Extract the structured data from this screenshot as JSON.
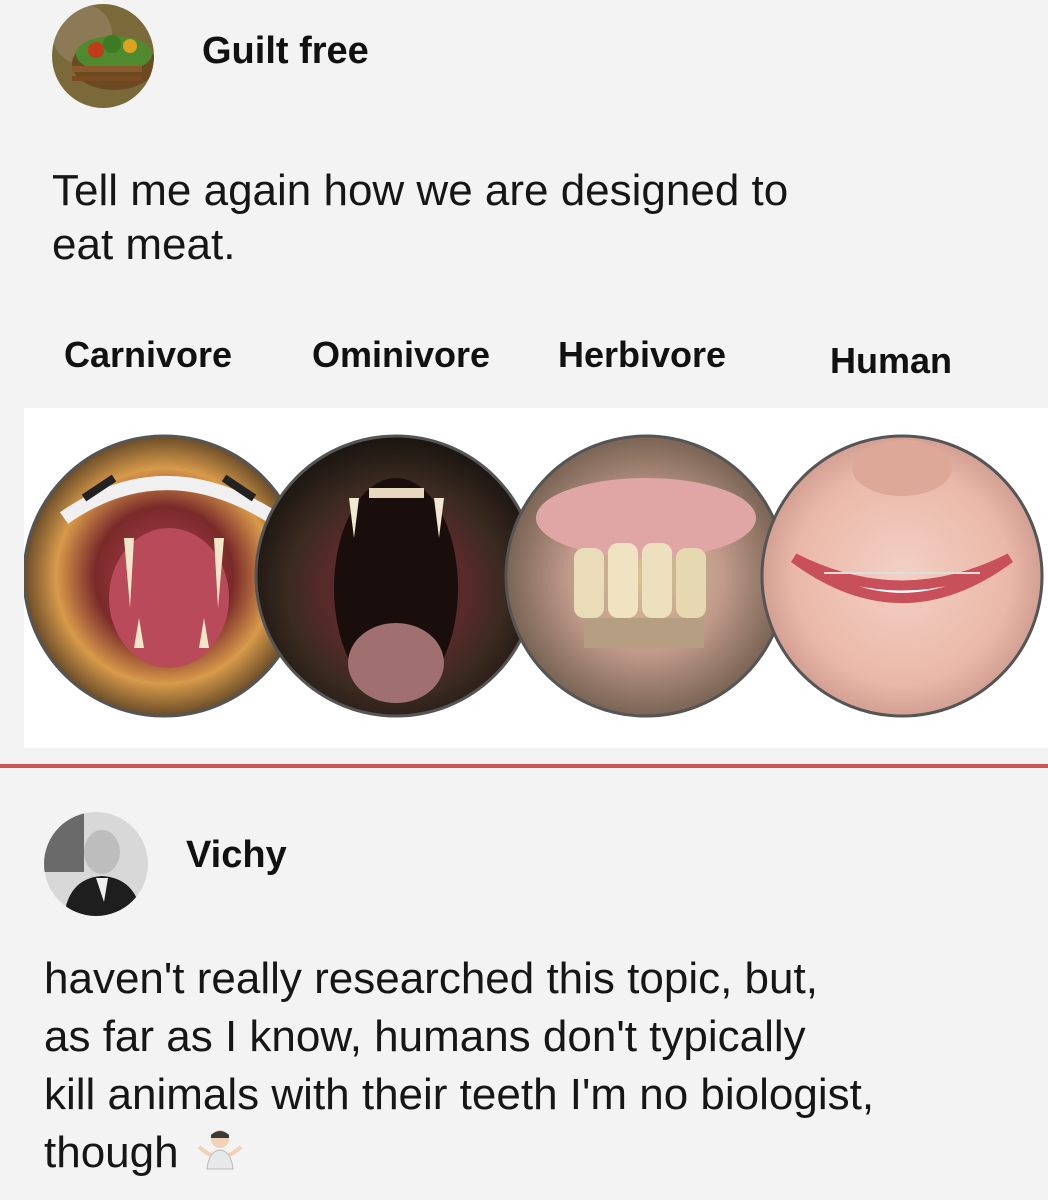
{
  "post": {
    "author": "Guilt free",
    "text_line1": "Tell me again how we are designed to",
    "text_line2": "eat meat.",
    "image": {
      "labels": [
        "Carnivore",
        "Ominivore",
        "Herbivore",
        "Human"
      ],
      "circles": [
        "tiger-mouth",
        "bear-mouth",
        "horse-teeth",
        "human-smile"
      ]
    }
  },
  "reply": {
    "author": "Vichy",
    "text_line1": "haven't really researched this topic, but,",
    "text_line2": "as far as I know, humans don't typically",
    "text_line3": "kill animals with their teeth I'm no biologist,",
    "text_line4": "though",
    "emoji": "person-shrugging-emoji"
  },
  "colors": {
    "background": "#f3f3f3",
    "divider": "#cc5555",
    "text": "#141414"
  }
}
